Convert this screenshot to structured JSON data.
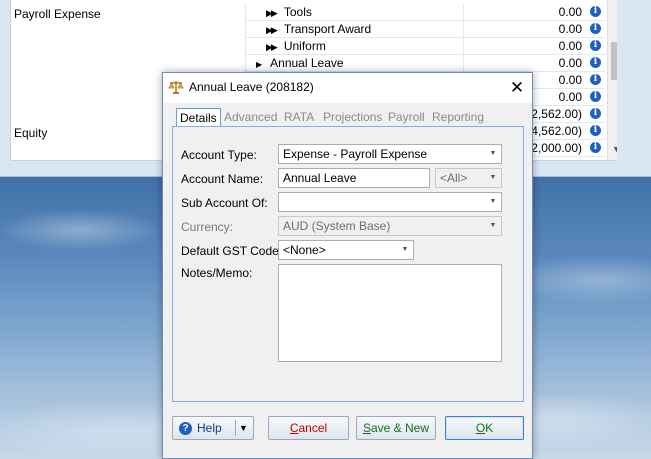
{
  "background_app": {
    "labels": {
      "payroll_expense": "Payroll Expense",
      "equity": "Equity"
    },
    "rows": [
      {
        "name": "Tools",
        "amount": "0.00",
        "expand": "double"
      },
      {
        "name": "Transport Award",
        "amount": "0.00",
        "expand": "double"
      },
      {
        "name": "Uniform",
        "amount": "0.00",
        "expand": "double"
      },
      {
        "name": "Annual Leave",
        "amount": "0.00",
        "expand": "single"
      },
      {
        "name": "",
        "amount": "0.00",
        "expand": "none"
      },
      {
        "name": "",
        "amount": "0.00",
        "expand": "none"
      },
      {
        "name": "",
        "amount": "(2,562.00)",
        "expand": "none"
      },
      {
        "name": "",
        "amount": "(4,562.00)",
        "expand": "none"
      },
      {
        "name": "",
        "amount": "(2,000.00)",
        "expand": "none"
      }
    ]
  },
  "dialog": {
    "title": "Annual Leave (208182)",
    "icon": "scales-icon",
    "tabs": [
      "Details",
      "Advanced",
      "RATA",
      "Projections",
      "Payroll",
      "Reporting"
    ],
    "active_tab": "Details",
    "fields": {
      "account_type": {
        "label": "Account Type:",
        "value": "Expense - Payroll Expense"
      },
      "account_name": {
        "label": "Account Name:",
        "value": "Annual Leave",
        "scope": "<All>"
      },
      "sub_account_of": {
        "label": "Sub Account Of:",
        "value": ""
      },
      "currency": {
        "label": "Currency:",
        "value": "AUD (System Base)"
      },
      "default_gst_code": {
        "label": "Default GST Code:",
        "value": "<None>"
      },
      "notes_memo": {
        "label": "Notes/Memo:",
        "value": ""
      }
    },
    "buttons": {
      "help": "Help",
      "cancel_prefix": "C",
      "cancel_rest": "ancel",
      "save_new_prefix": "S",
      "save_new_rest": "ave & New",
      "ok_prefix": "O",
      "ok_rest": "K"
    }
  },
  "colors": {
    "dialog_border": "#6d8fb5",
    "tab_border": "#89aede",
    "cancel_text": "#c00000",
    "confirm_text": "#1b6e1b",
    "help_text": "#0c3a8c"
  }
}
